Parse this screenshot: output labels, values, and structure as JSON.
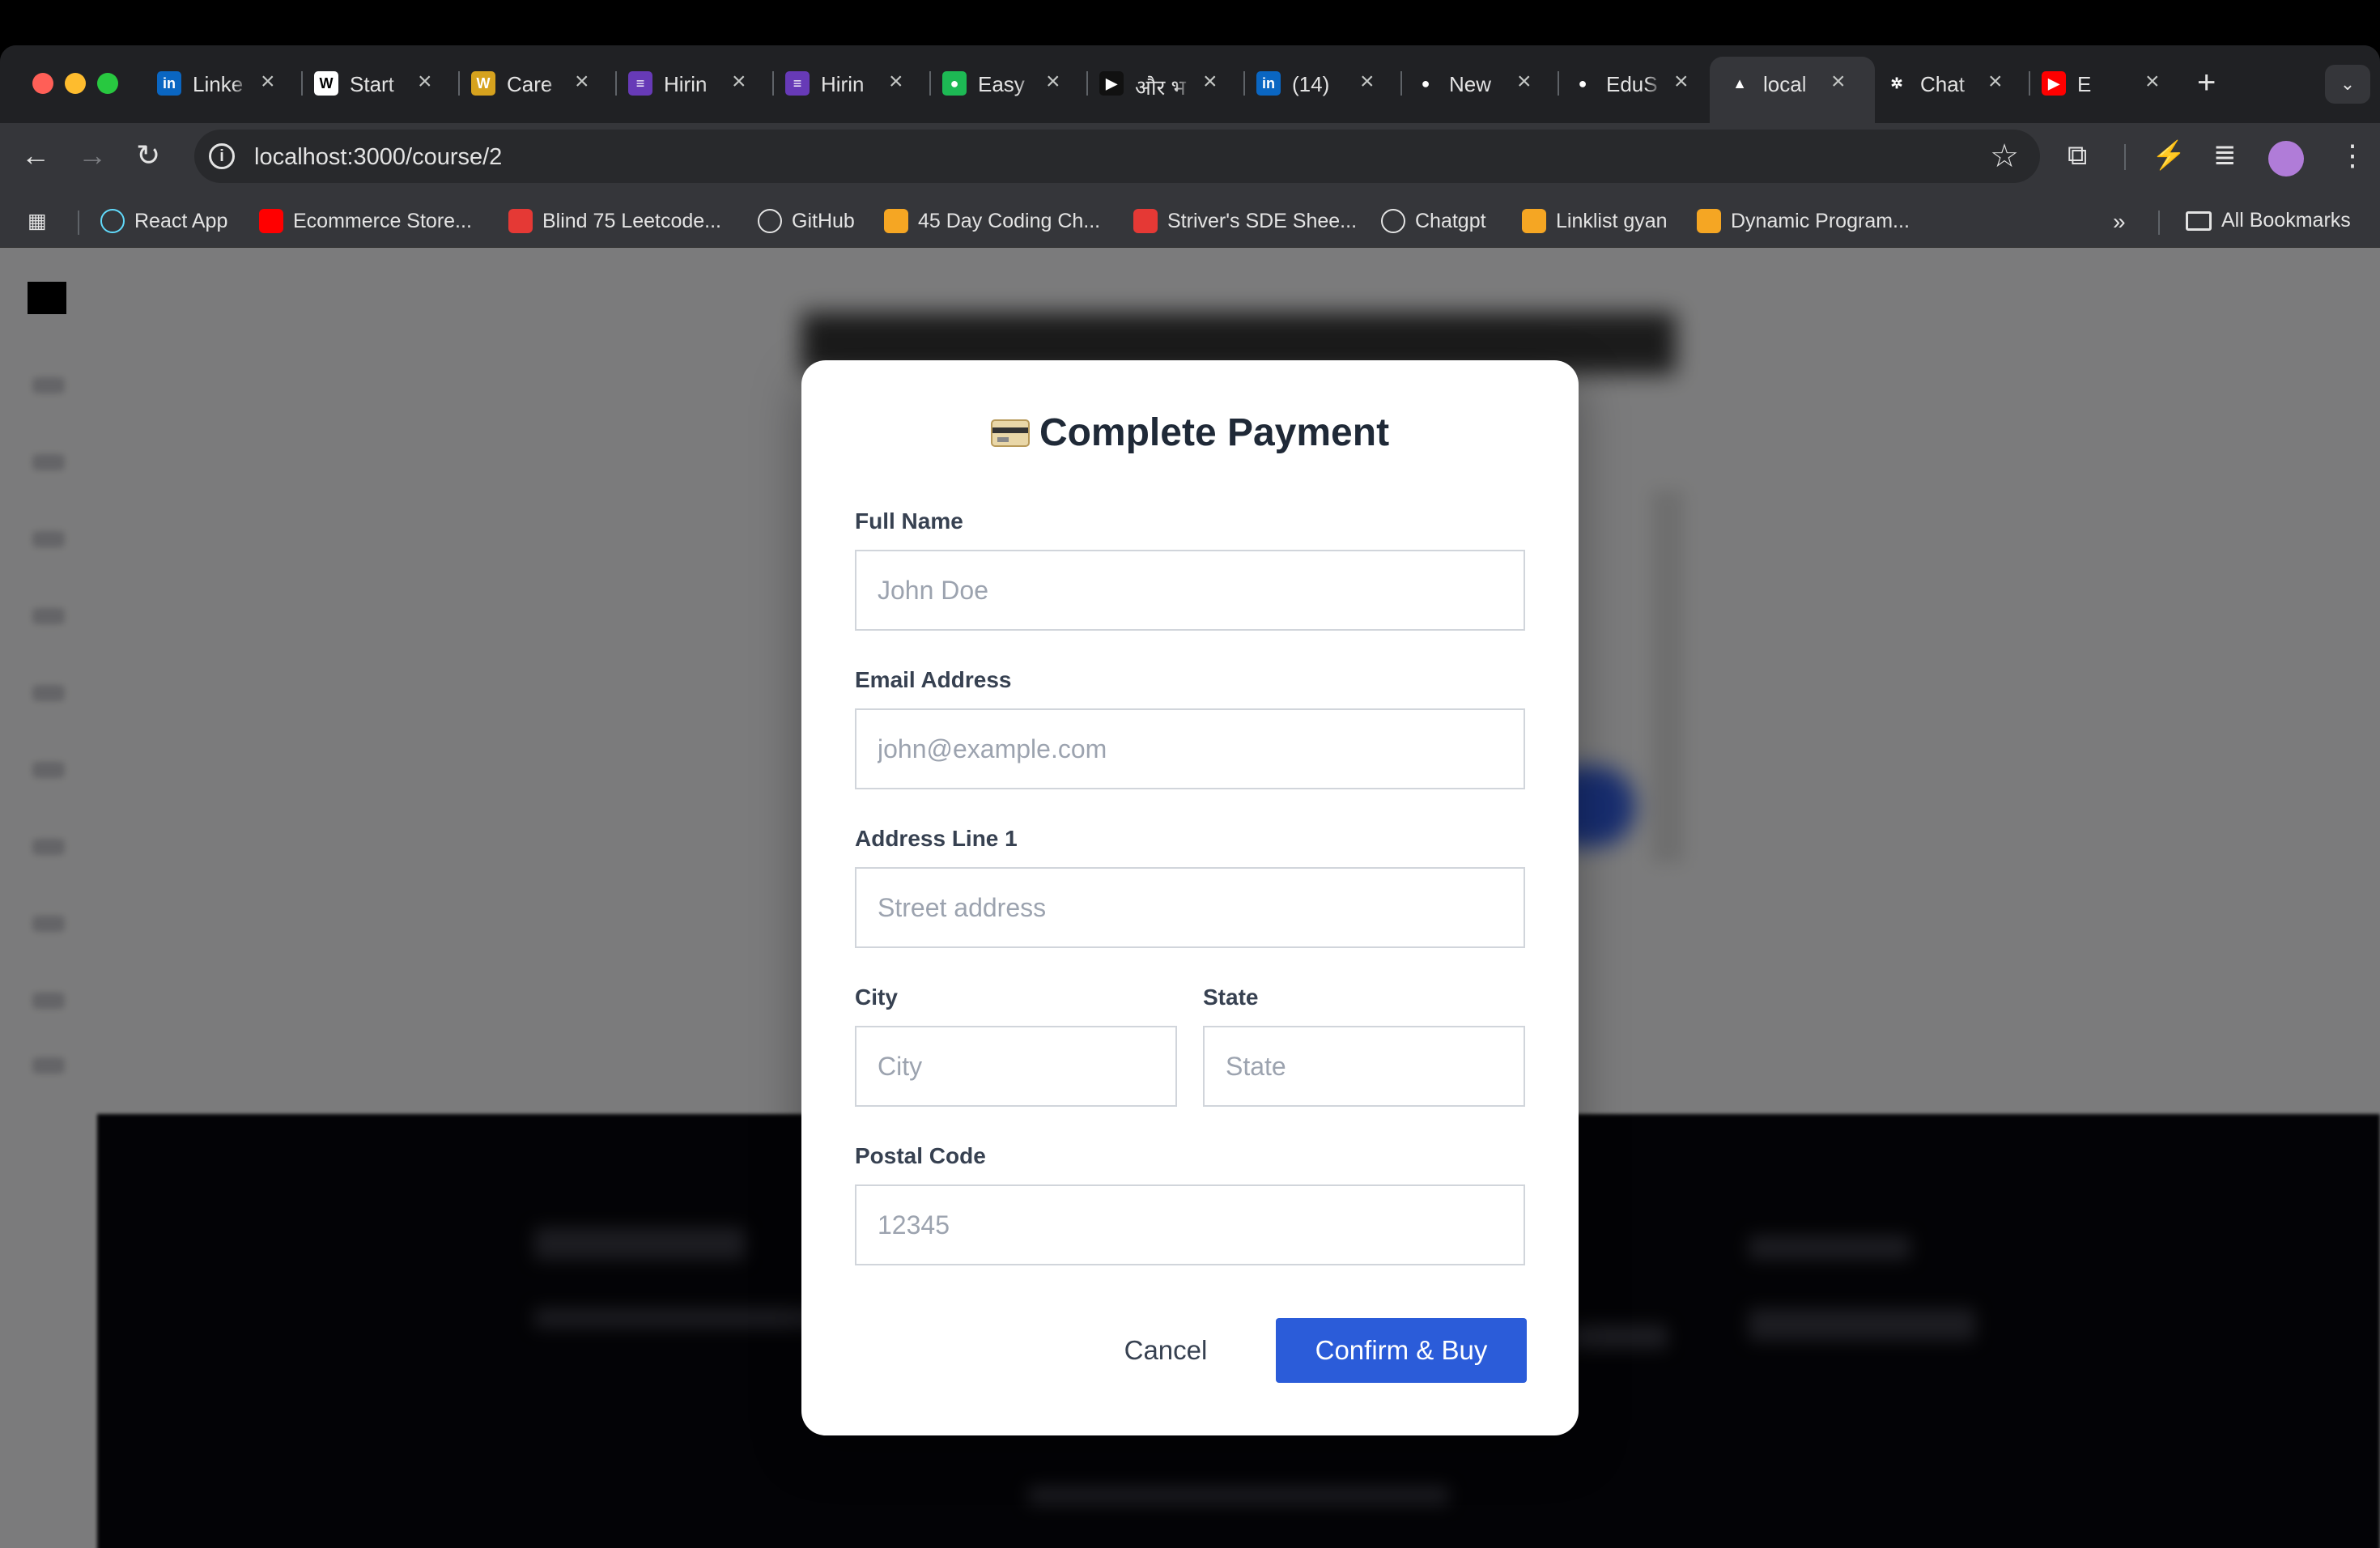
{
  "browser": {
    "tabs": [
      {
        "title": "Linke",
        "icon": "linkedin-icon",
        "color": "#0a66c2",
        "glyph": "in"
      },
      {
        "title": "Start",
        "icon": "wellfound-icon",
        "color": "#ffffff",
        "glyph": "W"
      },
      {
        "title": "Care",
        "icon": "careers-icon",
        "color": "#d6a21e",
        "glyph": "W"
      },
      {
        "title": "Hirin",
        "icon": "form-icon",
        "color": "#673ab7",
        "glyph": "≡"
      },
      {
        "title": "Hirin",
        "icon": "form-icon",
        "color": "#673ab7",
        "glyph": "≡"
      },
      {
        "title": "Easy",
        "icon": "easy-icon",
        "color": "#1db954",
        "glyph": "●"
      },
      {
        "title": "और भ",
        "icon": "video-icon",
        "color": "#111111",
        "glyph": "▶"
      },
      {
        "title": "(14)",
        "icon": "linkedin-icon",
        "color": "#0a66c2",
        "glyph": "in"
      },
      {
        "title": "New",
        "icon": "github-icon",
        "color": "#ffffff",
        "glyph": "●"
      },
      {
        "title": "EduS",
        "icon": "github-icon",
        "color": "#ffffff",
        "glyph": "●"
      },
      {
        "title": "local",
        "icon": "nextjs-icon",
        "color": "#ffffff",
        "glyph": "▲"
      },
      {
        "title": "Chat",
        "icon": "chatgpt-icon",
        "color": "#ffffff",
        "glyph": "✲"
      },
      {
        "title": "E",
        "icon": "youtube-icon",
        "color": "#ff0000",
        "glyph": "▶"
      }
    ],
    "url": "localhost:3000/course/2",
    "bookmarks": [
      {
        "label": "React App",
        "icon": "react-icon",
        "color": "#61dafb"
      },
      {
        "label": "Ecommerce Store...",
        "icon": "youtube-icon",
        "color": "#ff0000"
      },
      {
        "label": "Blind 75 Leetcode...",
        "icon": "tuf-icon",
        "color": "#e53935"
      },
      {
        "label": "GitHub",
        "icon": "github-icon",
        "color": "#ffffff"
      },
      {
        "label": "45 Day Coding Ch...",
        "icon": "coding-icon",
        "color": "#f5a623"
      },
      {
        "label": "Striver's SDE Shee...",
        "icon": "tuf-icon",
        "color": "#e53935"
      },
      {
        "label": "Chatgpt",
        "icon": "chatgpt-icon",
        "color": "#ffffff"
      },
      {
        "label": "Linklist gyan",
        "icon": "linklist-icon",
        "color": "#f5a623"
      },
      {
        "label": "Dynamic Program...",
        "icon": "linklist-icon",
        "color": "#f5a623"
      }
    ],
    "all_bookmarks_label": "All Bookmarks"
  },
  "modal": {
    "title": "Complete Payment",
    "title_icon": "credit-card-icon",
    "fields": {
      "full_name": {
        "label": "Full Name",
        "placeholder": "John Doe",
        "value": ""
      },
      "email": {
        "label": "Email Address",
        "placeholder": "john@example.com",
        "value": ""
      },
      "address1": {
        "label": "Address Line 1",
        "placeholder": "Street address",
        "value": ""
      },
      "city": {
        "label": "City",
        "placeholder": "City",
        "value": ""
      },
      "state": {
        "label": "State",
        "placeholder": "State",
        "value": ""
      },
      "postal": {
        "label": "Postal Code",
        "placeholder": "12345",
        "value": ""
      }
    },
    "cancel_label": "Cancel",
    "confirm_label": "Confirm & Buy",
    "accent": "#2b5cd9"
  }
}
